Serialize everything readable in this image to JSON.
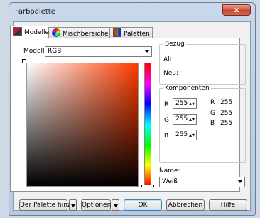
{
  "window": {
    "title": "Farbpalette",
    "close_glyph": "x"
  },
  "tabs": [
    {
      "label": "Modelle",
      "icon": "models-icon",
      "active": true
    },
    {
      "label": "Mischbereiche",
      "icon": "mixers-icon",
      "active": false
    },
    {
      "label": "Paletten",
      "icon": "palettes-icon",
      "active": false
    }
  ],
  "model": {
    "label": "Modell:",
    "value": "RGB"
  },
  "reference": {
    "title": "Bezug",
    "old_label": "Alt:",
    "new_label": "Neu:"
  },
  "components": {
    "title": "Komponenten",
    "inputs": [
      {
        "label": "R",
        "value": "255"
      },
      {
        "label": "G",
        "value": "255"
      },
      {
        "label": "B",
        "value": "255"
      }
    ],
    "readout": [
      {
        "label": "R",
        "value": "255"
      },
      {
        "label": "G",
        "value": "255"
      },
      {
        "label": "B",
        "value": "255"
      }
    ]
  },
  "name": {
    "label": "Name:",
    "value": "Weiß"
  },
  "buttons": {
    "add_to_palette": "Der Palette hinz.",
    "options": "Optionen",
    "ok": "OK",
    "cancel": "Abbrechen",
    "help": "Hilfe"
  },
  "colors": {
    "accent": "#ff3b00",
    "close": "#c44a31"
  }
}
